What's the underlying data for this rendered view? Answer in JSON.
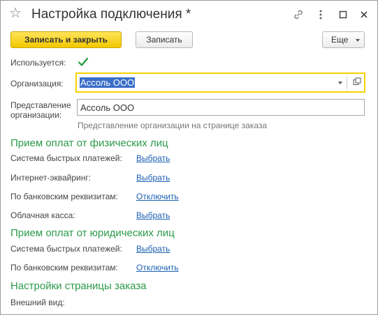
{
  "window": {
    "title": "Настройка подключения *",
    "icons": [
      "star-icon",
      "link-icon",
      "more-icon",
      "maximize-icon",
      "close-icon"
    ]
  },
  "toolbar": {
    "save_close_label": "Записать и закрыть",
    "save_label": "Записать",
    "more_label": "Еще"
  },
  "form": {
    "used_label": "Используется:",
    "used_checked": true,
    "org_label": "Организация:",
    "org_value": "Ассоль ООО",
    "repr_label_1": "Представление",
    "repr_label_2": "организации:",
    "repr_value": "Ассоль ООО",
    "repr_hint": "Представление организации на странице заказа"
  },
  "sections": {
    "individuals": {
      "title": "Прием оплат от физических лиц",
      "rows": [
        {
          "label": "Система быстрых платежей:",
          "action": "Выбрать"
        },
        {
          "label": "Интернет-эквайринг:",
          "action": "Выбрать"
        },
        {
          "label": "По банковским реквизитам:",
          "action": "Отключить"
        },
        {
          "label": "Облачная касса:",
          "action": "Выбрать"
        }
      ]
    },
    "legal": {
      "title": "Прием оплат от юридических лиц",
      "rows": [
        {
          "label": "Система быстрых платежей:",
          "action": "Выбрать"
        },
        {
          "label": "По банковским реквизитам:",
          "action": "Отключить"
        }
      ]
    },
    "order_page": {
      "title": "Настройки страницы заказа",
      "appearance_label": "Внешний вид:"
    }
  },
  "colors": {
    "accent_yellow": "#f2c800",
    "section_green": "#2b9a4a",
    "link_blue": "#1b5fb3",
    "selection_blue": "#3a6fc8",
    "check_green": "#1f9a3a"
  }
}
